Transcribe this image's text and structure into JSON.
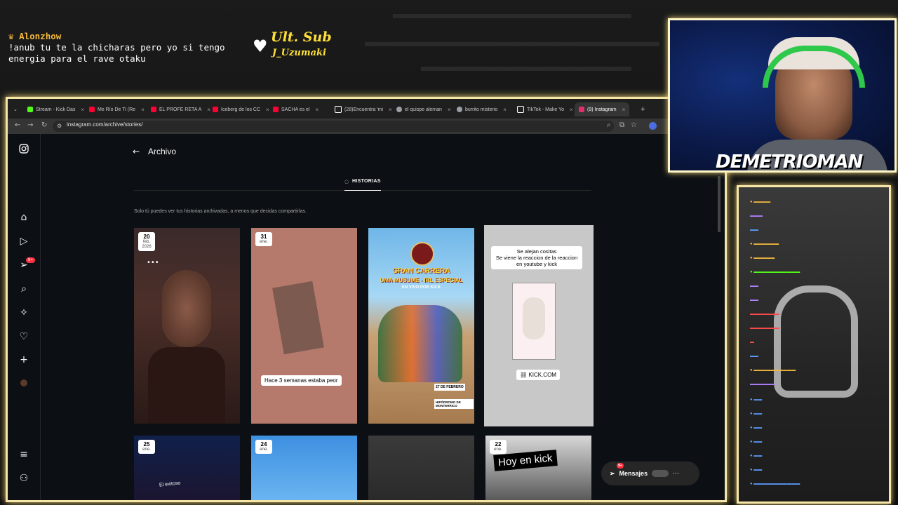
{
  "overlay": {
    "chat_alert": {
      "user": "Alonzhow",
      "message": "!anub tu te la chicharas pero yo si tengo energia para el rave otaku"
    },
    "last_sub": {
      "title": "Ult. Sub",
      "name": "J_Uzumaki"
    },
    "streamer_name": "DEMETRIOMAN",
    "accent_color": "#f5e6a8"
  },
  "browser": {
    "tabs": [
      {
        "label": "Stream - Kick Das",
        "color": "#53fc18"
      },
      {
        "label": "Me Río De Ti (Re",
        "color": "#ff0033"
      },
      {
        "label": "EL PROFE RETA A",
        "color": "#ff0033"
      },
      {
        "label": "Iceberg de los CC",
        "color": "#ff0033"
      },
      {
        "label": "SACHA es el",
        "color": "#ff0033"
      },
      {
        "label": "(28)Encuentra 'mi",
        "color": "#ffffff"
      },
      {
        "label": "el quispe aleman",
        "color": "#9aa0a6"
      },
      {
        "label": "burrito misterio",
        "color": "#9aa0a6"
      },
      {
        "label": "TikTok - Make Yo",
        "color": "#ffffff"
      },
      {
        "label": "(9) Instagram",
        "color": "#e1306c"
      }
    ],
    "url": "instagram.com/archive/stories/"
  },
  "instagram": {
    "page_title": "Archivo",
    "tab_label": "HISTORIAS",
    "note": "Solo tú puedes ver tus historias archivadas, a menos que decidas compartirlas.",
    "notification_badge": "9+",
    "messages_label": "Mensajes",
    "messages_badge": "9+",
    "stories": [
      {
        "day": "20",
        "month": "feb.",
        "year": "2026",
        "caption": ""
      },
      {
        "day": "31",
        "month": "ene.",
        "year": "",
        "caption": "Hace 3 semanas estaba peor"
      },
      {
        "day": "",
        "month": "",
        "year": "",
        "caption": ""
      },
      {
        "day": "",
        "month": "",
        "year": "",
        "caption": "Se alejan cositas \n Se viene la reaccion de la reaccion en youtube y kick"
      },
      {
        "day": "25",
        "month": "ene.",
        "year": "",
        "caption": "El exitoso"
      },
      {
        "day": "24",
        "month": "ene.",
        "year": "",
        "caption": ""
      },
      {
        "day": "",
        "month": "",
        "year": "",
        "caption": ""
      },
      {
        "day": "22",
        "month": "ene.",
        "year": "",
        "caption": "Hoy en kick"
      }
    ],
    "poster": {
      "line1": "GRAN CARRERA",
      "line2": "UMA MUSUME - IRL ESPECIAL",
      "line3": "EN VIVO POR KICK",
      "date": "27 DE FEBRERO",
      "place": "HIPÓDROMO DE MONTERRICO"
    },
    "kick_link": "KICK.COM"
  }
}
